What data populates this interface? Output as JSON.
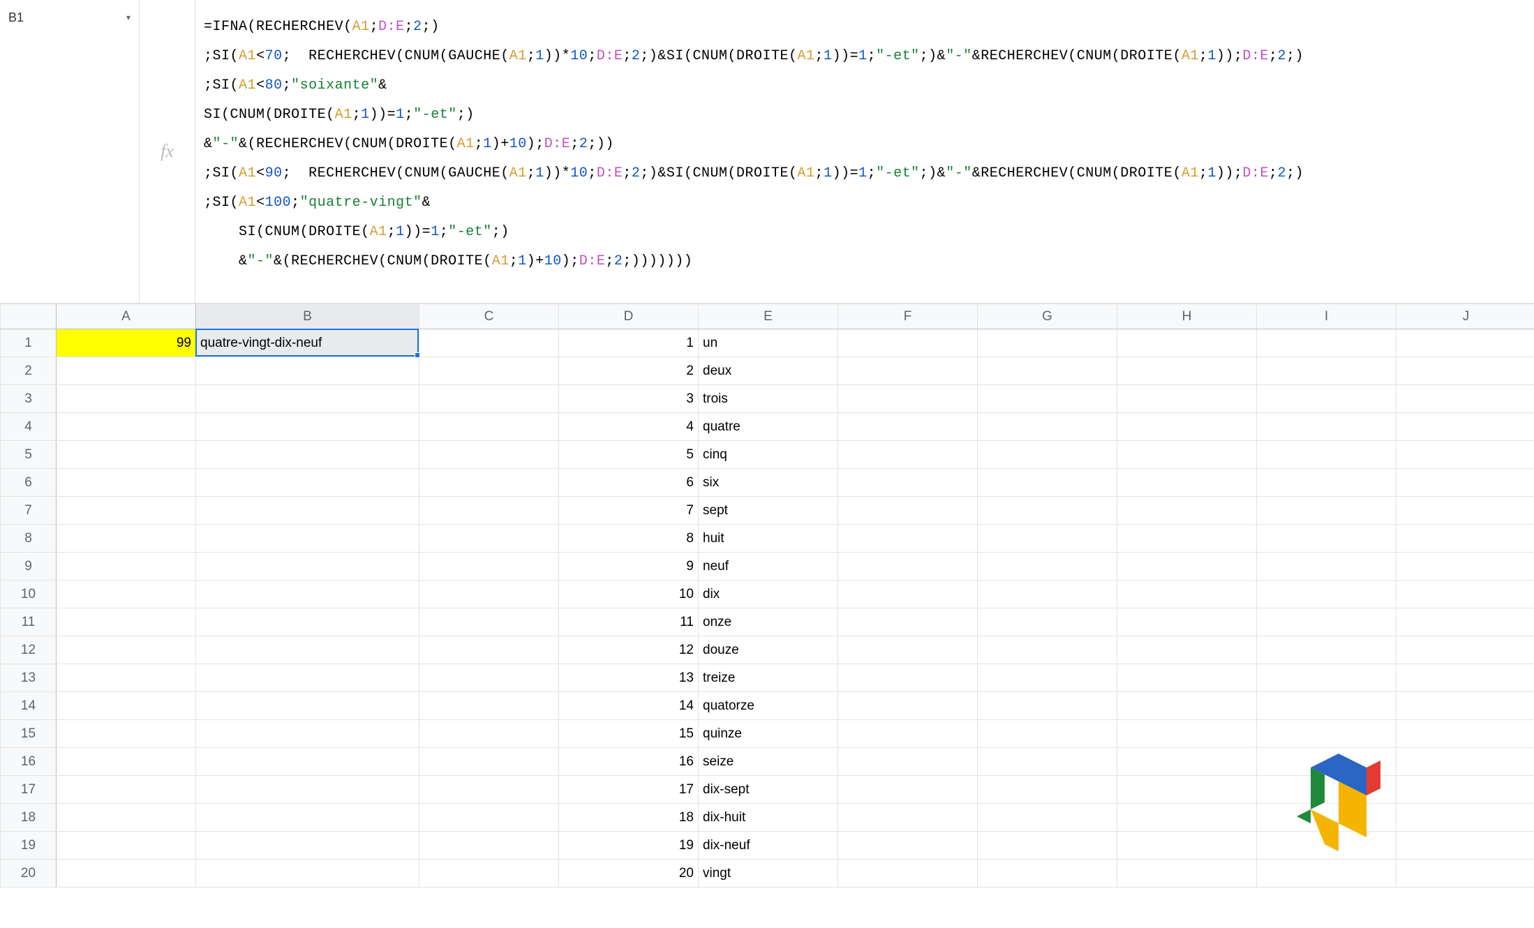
{
  "nameBox": {
    "value": "B1"
  },
  "fx": {
    "symbol": "fx"
  },
  "formula": {
    "lines": [
      [
        {
          "t": "eq",
          "v": "="
        },
        {
          "t": "fn",
          "v": "IFNA"
        },
        {
          "t": "paren",
          "v": "("
        },
        {
          "t": "fn",
          "v": "RECHERCHEV"
        },
        {
          "t": "paren",
          "v": "("
        },
        {
          "t": "refA",
          "v": "A1"
        },
        {
          "t": "semi",
          "v": ";"
        },
        {
          "t": "refDE",
          "v": "D:E"
        },
        {
          "t": "semi",
          "v": ";"
        },
        {
          "t": "num",
          "v": "2"
        },
        {
          "t": "semi",
          "v": ";"
        },
        {
          "t": "paren",
          "v": ")"
        }
      ],
      [
        {
          "t": "semi",
          "v": ";"
        },
        {
          "t": "fn",
          "v": "SI"
        },
        {
          "t": "paren",
          "v": "("
        },
        {
          "t": "refA",
          "v": "A1"
        },
        {
          "t": "op",
          "v": "<"
        },
        {
          "t": "num",
          "v": "70"
        },
        {
          "t": "semi",
          "v": ";  "
        },
        {
          "t": "fn",
          "v": "RECHERCHEV"
        },
        {
          "t": "paren",
          "v": "("
        },
        {
          "t": "fn",
          "v": "CNUM"
        },
        {
          "t": "paren",
          "v": "("
        },
        {
          "t": "fn",
          "v": "GAUCHE"
        },
        {
          "t": "paren",
          "v": "("
        },
        {
          "t": "refA",
          "v": "A1"
        },
        {
          "t": "semi",
          "v": ";"
        },
        {
          "t": "num",
          "v": "1"
        },
        {
          "t": "paren",
          "v": "))"
        },
        {
          "t": "op",
          "v": "*"
        },
        {
          "t": "num",
          "v": "10"
        },
        {
          "t": "semi",
          "v": ";"
        },
        {
          "t": "refDE",
          "v": "D:E"
        },
        {
          "t": "semi",
          "v": ";"
        },
        {
          "t": "num",
          "v": "2"
        },
        {
          "t": "semi",
          "v": ";"
        },
        {
          "t": "paren",
          "v": ")"
        },
        {
          "t": "op",
          "v": "&"
        },
        {
          "t": "fn",
          "v": "SI"
        },
        {
          "t": "paren",
          "v": "("
        },
        {
          "t": "fn",
          "v": "CNUM"
        },
        {
          "t": "paren",
          "v": "("
        },
        {
          "t": "fn",
          "v": "DROITE"
        },
        {
          "t": "paren",
          "v": "("
        },
        {
          "t": "refA",
          "v": "A1"
        },
        {
          "t": "semi",
          "v": ";"
        },
        {
          "t": "num",
          "v": "1"
        },
        {
          "t": "paren",
          "v": "))"
        },
        {
          "t": "op",
          "v": "="
        },
        {
          "t": "num",
          "v": "1"
        },
        {
          "t": "semi",
          "v": ";"
        },
        {
          "t": "str",
          "v": "\"-et\""
        },
        {
          "t": "semi",
          "v": ";"
        },
        {
          "t": "paren",
          "v": ")"
        },
        {
          "t": "op",
          "v": "&"
        },
        {
          "t": "str",
          "v": "\"-\""
        },
        {
          "t": "op",
          "v": "&"
        },
        {
          "t": "fn",
          "v": "RECHERCHEV"
        },
        {
          "t": "paren",
          "v": "("
        },
        {
          "t": "fn",
          "v": "CNUM"
        },
        {
          "t": "paren",
          "v": "("
        },
        {
          "t": "fn",
          "v": "DROITE"
        },
        {
          "t": "paren",
          "v": "("
        },
        {
          "t": "refA",
          "v": "A1"
        },
        {
          "t": "semi",
          "v": ";"
        },
        {
          "t": "num",
          "v": "1"
        },
        {
          "t": "paren",
          "v": "))"
        },
        {
          "t": "semi",
          "v": ";"
        },
        {
          "t": "refDE",
          "v": "D:E"
        },
        {
          "t": "semi",
          "v": ";"
        },
        {
          "t": "num",
          "v": "2"
        },
        {
          "t": "semi",
          "v": ";"
        },
        {
          "t": "paren",
          "v": ")"
        }
      ],
      [
        {
          "t": "semi",
          "v": ";"
        },
        {
          "t": "fn",
          "v": "SI"
        },
        {
          "t": "paren",
          "v": "("
        },
        {
          "t": "refA",
          "v": "A1"
        },
        {
          "t": "op",
          "v": "<"
        },
        {
          "t": "num",
          "v": "80"
        },
        {
          "t": "semi",
          "v": ";"
        },
        {
          "t": "str",
          "v": "\"soixante\""
        },
        {
          "t": "op",
          "v": "&"
        }
      ],
      [
        {
          "t": "fn",
          "v": "SI"
        },
        {
          "t": "paren",
          "v": "("
        },
        {
          "t": "fn",
          "v": "CNUM"
        },
        {
          "t": "paren",
          "v": "("
        },
        {
          "t": "fn",
          "v": "DROITE"
        },
        {
          "t": "paren",
          "v": "("
        },
        {
          "t": "refA",
          "v": "A1"
        },
        {
          "t": "semi",
          "v": ";"
        },
        {
          "t": "num",
          "v": "1"
        },
        {
          "t": "paren",
          "v": "))"
        },
        {
          "t": "op",
          "v": "="
        },
        {
          "t": "num",
          "v": "1"
        },
        {
          "t": "semi",
          "v": ";"
        },
        {
          "t": "str",
          "v": "\"-et\""
        },
        {
          "t": "semi",
          "v": ";"
        },
        {
          "t": "paren",
          "v": ")"
        }
      ],
      [
        {
          "t": "op",
          "v": "&"
        },
        {
          "t": "str",
          "v": "\"-\""
        },
        {
          "t": "op",
          "v": "&"
        },
        {
          "t": "paren",
          "v": "("
        },
        {
          "t": "fn",
          "v": "RECHERCHEV"
        },
        {
          "t": "paren",
          "v": "("
        },
        {
          "t": "fn",
          "v": "CNUM"
        },
        {
          "t": "paren",
          "v": "("
        },
        {
          "t": "fn",
          "v": "DROITE"
        },
        {
          "t": "paren",
          "v": "("
        },
        {
          "t": "refA",
          "v": "A1"
        },
        {
          "t": "semi",
          "v": ";"
        },
        {
          "t": "num",
          "v": "1"
        },
        {
          "t": "paren",
          "v": ")"
        },
        {
          "t": "op",
          "v": "+"
        },
        {
          "t": "num",
          "v": "10"
        },
        {
          "t": "paren",
          "v": ")"
        },
        {
          "t": "semi",
          "v": ";"
        },
        {
          "t": "refDE",
          "v": "D:E"
        },
        {
          "t": "semi",
          "v": ";"
        },
        {
          "t": "num",
          "v": "2"
        },
        {
          "t": "semi",
          "v": ";"
        },
        {
          "t": "paren",
          "v": "))"
        }
      ],
      [
        {
          "t": "semi",
          "v": ";"
        },
        {
          "t": "fn",
          "v": "SI"
        },
        {
          "t": "paren",
          "v": "("
        },
        {
          "t": "refA",
          "v": "A1"
        },
        {
          "t": "op",
          "v": "<"
        },
        {
          "t": "num",
          "v": "90"
        },
        {
          "t": "semi",
          "v": ";  "
        },
        {
          "t": "fn",
          "v": "RECHERCHEV"
        },
        {
          "t": "paren",
          "v": "("
        },
        {
          "t": "fn",
          "v": "CNUM"
        },
        {
          "t": "paren",
          "v": "("
        },
        {
          "t": "fn",
          "v": "GAUCHE"
        },
        {
          "t": "paren",
          "v": "("
        },
        {
          "t": "refA",
          "v": "A1"
        },
        {
          "t": "semi",
          "v": ";"
        },
        {
          "t": "num",
          "v": "1"
        },
        {
          "t": "paren",
          "v": "))"
        },
        {
          "t": "op",
          "v": "*"
        },
        {
          "t": "num",
          "v": "10"
        },
        {
          "t": "semi",
          "v": ";"
        },
        {
          "t": "refDE",
          "v": "D:E"
        },
        {
          "t": "semi",
          "v": ";"
        },
        {
          "t": "num",
          "v": "2"
        },
        {
          "t": "semi",
          "v": ";"
        },
        {
          "t": "paren",
          "v": ")"
        },
        {
          "t": "op",
          "v": "&"
        },
        {
          "t": "fn",
          "v": "SI"
        },
        {
          "t": "paren",
          "v": "("
        },
        {
          "t": "fn",
          "v": "CNUM"
        },
        {
          "t": "paren",
          "v": "("
        },
        {
          "t": "fn",
          "v": "DROITE"
        },
        {
          "t": "paren",
          "v": "("
        },
        {
          "t": "refA",
          "v": "A1"
        },
        {
          "t": "semi",
          "v": ";"
        },
        {
          "t": "num",
          "v": "1"
        },
        {
          "t": "paren",
          "v": "))"
        },
        {
          "t": "op",
          "v": "="
        },
        {
          "t": "num",
          "v": "1"
        },
        {
          "t": "semi",
          "v": ";"
        },
        {
          "t": "str",
          "v": "\"-et\""
        },
        {
          "t": "semi",
          "v": ";"
        },
        {
          "t": "paren",
          "v": ")"
        },
        {
          "t": "op",
          "v": "&"
        },
        {
          "t": "str",
          "v": "\"-\""
        },
        {
          "t": "op",
          "v": "&"
        },
        {
          "t": "fn",
          "v": "RECHERCHEV"
        },
        {
          "t": "paren",
          "v": "("
        },
        {
          "t": "fn",
          "v": "CNUM"
        },
        {
          "t": "paren",
          "v": "("
        },
        {
          "t": "fn",
          "v": "DROITE"
        },
        {
          "t": "paren",
          "v": "("
        },
        {
          "t": "refA",
          "v": "A1"
        },
        {
          "t": "semi",
          "v": ";"
        },
        {
          "t": "num",
          "v": "1"
        },
        {
          "t": "paren",
          "v": "))"
        },
        {
          "t": "semi",
          "v": ";"
        },
        {
          "t": "refDE",
          "v": "D:E"
        },
        {
          "t": "semi",
          "v": ";"
        },
        {
          "t": "num",
          "v": "2"
        },
        {
          "t": "semi",
          "v": ";"
        },
        {
          "t": "paren",
          "v": ")"
        }
      ],
      [
        {
          "t": "semi",
          "v": ";"
        },
        {
          "t": "fn",
          "v": "SI"
        },
        {
          "t": "paren",
          "v": "("
        },
        {
          "t": "refA",
          "v": "A1"
        },
        {
          "t": "op",
          "v": "<"
        },
        {
          "t": "num",
          "v": "100"
        },
        {
          "t": "semi",
          "v": ";"
        },
        {
          "t": "str",
          "v": "\"quatre-vingt\""
        },
        {
          "t": "op",
          "v": "&"
        }
      ],
      [
        {
          "t": "pad",
          "v": "    "
        },
        {
          "t": "fn",
          "v": "SI"
        },
        {
          "t": "paren",
          "v": "("
        },
        {
          "t": "fn",
          "v": "CNUM"
        },
        {
          "t": "paren",
          "v": "("
        },
        {
          "t": "fn",
          "v": "DROITE"
        },
        {
          "t": "paren",
          "v": "("
        },
        {
          "t": "refA",
          "v": "A1"
        },
        {
          "t": "semi",
          "v": ";"
        },
        {
          "t": "num",
          "v": "1"
        },
        {
          "t": "paren",
          "v": "))"
        },
        {
          "t": "op",
          "v": "="
        },
        {
          "t": "num",
          "v": "1"
        },
        {
          "t": "semi",
          "v": ";"
        },
        {
          "t": "str",
          "v": "\"-et\""
        },
        {
          "t": "semi",
          "v": ";"
        },
        {
          "t": "paren",
          "v": ")"
        }
      ],
      [
        {
          "t": "pad",
          "v": "    "
        },
        {
          "t": "op",
          "v": "&"
        },
        {
          "t": "str",
          "v": "\"-\""
        },
        {
          "t": "op",
          "v": "&"
        },
        {
          "t": "paren",
          "v": "("
        },
        {
          "t": "fn",
          "v": "RECHERCHEV"
        },
        {
          "t": "paren",
          "v": "("
        },
        {
          "t": "fn",
          "v": "CNUM"
        },
        {
          "t": "paren",
          "v": "("
        },
        {
          "t": "fn",
          "v": "DROITE"
        },
        {
          "t": "paren",
          "v": "("
        },
        {
          "t": "refA",
          "v": "A1"
        },
        {
          "t": "semi",
          "v": ";"
        },
        {
          "t": "num",
          "v": "1"
        },
        {
          "t": "paren",
          "v": ")"
        },
        {
          "t": "op",
          "v": "+"
        },
        {
          "t": "num",
          "v": "10"
        },
        {
          "t": "paren",
          "v": ")"
        },
        {
          "t": "semi",
          "v": ";"
        },
        {
          "t": "refDE",
          "v": "D:E"
        },
        {
          "t": "semi",
          "v": ";"
        },
        {
          "t": "num",
          "v": "2"
        },
        {
          "t": "semi",
          "v": ";"
        },
        {
          "t": "paren",
          "v": ")))))))"
        }
      ]
    ]
  },
  "columns": [
    "A",
    "B",
    "C",
    "D",
    "E",
    "F",
    "G",
    "H",
    "I",
    "J"
  ],
  "rows": [
    {
      "n": 1,
      "A": "99",
      "B": "quatre-vingt-dix-neuf",
      "D": "1",
      "E": "un"
    },
    {
      "n": 2,
      "D": "2",
      "E": "deux"
    },
    {
      "n": 3,
      "D": "3",
      "E": "trois"
    },
    {
      "n": 4,
      "D": "4",
      "E": "quatre"
    },
    {
      "n": 5,
      "D": "5",
      "E": "cinq"
    },
    {
      "n": 6,
      "D": "6",
      "E": "six"
    },
    {
      "n": 7,
      "D": "7",
      "E": "sept"
    },
    {
      "n": 8,
      "D": "8",
      "E": "huit"
    },
    {
      "n": 9,
      "D": "9",
      "E": "neuf"
    },
    {
      "n": 10,
      "D": "10",
      "E": "dix"
    },
    {
      "n": 11,
      "D": "11",
      "E": "onze"
    },
    {
      "n": 12,
      "D": "12",
      "E": "douze"
    },
    {
      "n": 13,
      "D": "13",
      "E": "treize"
    },
    {
      "n": 14,
      "D": "14",
      "E": "quatorze"
    },
    {
      "n": 15,
      "D": "15",
      "E": "quinze"
    },
    {
      "n": 16,
      "D": "16",
      "E": "seize"
    },
    {
      "n": 17,
      "D": "17",
      "E": "dix-sept"
    },
    {
      "n": 18,
      "D": "18",
      "E": "dix-huit"
    },
    {
      "n": 19,
      "D": "19",
      "E": "dix-neuf"
    },
    {
      "n": 20,
      "D": "20",
      "E": "vingt"
    }
  ],
  "selection": {
    "cell": "B1"
  }
}
